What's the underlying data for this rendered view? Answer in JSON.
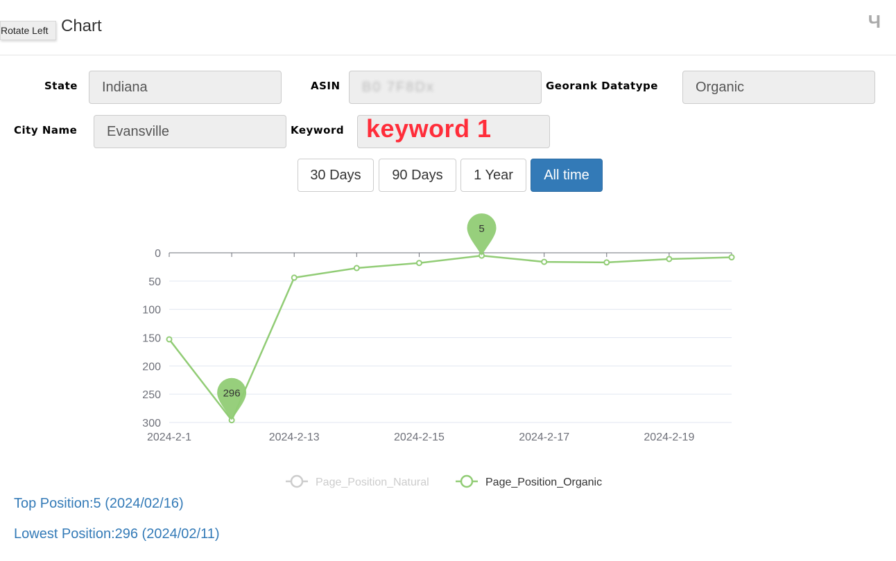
{
  "header": {
    "title": "Chart",
    "tooltip": "Rotate Left",
    "icon_glyph": "Ч"
  },
  "form": {
    "state_label": "State",
    "state_value": "Indiana",
    "asin_label": "ASIN",
    "asin_value": "B0 7F8Dx",
    "georank_label": "Georank  Datatype",
    "georank_value": "Organic",
    "city_label": "City  Name",
    "city_value": "Evansville",
    "keyword_label": "Keyword",
    "keyword_value": "",
    "keyword_overlay": "keyword 1"
  },
  "range_buttons": [
    {
      "label": "30 Days",
      "active": false
    },
    {
      "label": "90 Days",
      "active": false
    },
    {
      "label": "1 Year",
      "active": false
    },
    {
      "label": "All time",
      "active": true
    }
  ],
  "chart_data": {
    "type": "line",
    "y_inverted": true,
    "ylim": [
      0,
      300
    ],
    "yticks": [
      0,
      50,
      100,
      150,
      200,
      250,
      300
    ],
    "x": [
      "2024-2-1",
      "2024-2-11",
      "2024-2-13",
      "2024-2-14",
      "2024-2-15",
      "2024-2-16",
      "2024-2-17",
      "2024-2-18",
      "2024-2-19",
      "2024-2-20"
    ],
    "xtick_labels": [
      "2024-2-1",
      "2024-2-13",
      "2024-2-15",
      "2024-2-17",
      "2024-2-19"
    ],
    "xtick_label_indices": [
      0,
      2,
      4,
      6,
      8
    ],
    "series": [
      {
        "name": "Page_Position_Natural",
        "color": "#cccccc",
        "values": [],
        "visible": false
      },
      {
        "name": "Page_Position_Organic",
        "color": "#91cc75",
        "values": [
          153,
          296,
          44,
          27,
          18,
          5,
          16,
          17,
          11,
          8
        ],
        "visible": true
      }
    ],
    "markers": [
      {
        "label": "5",
        "index": 5,
        "value": 5
      },
      {
        "label": "296",
        "index": 1,
        "value": 296
      }
    ],
    "legend_position": "bottom-center",
    "grid": true
  },
  "stats": {
    "top": "Top Position:5 (2024/02/16)",
    "lowest": "Lowest Position:296 (2024/02/11)"
  },
  "colors": {
    "accent": "#337ab7",
    "series": "#91cc75",
    "keyword_overlay": "#ff2d3a"
  }
}
